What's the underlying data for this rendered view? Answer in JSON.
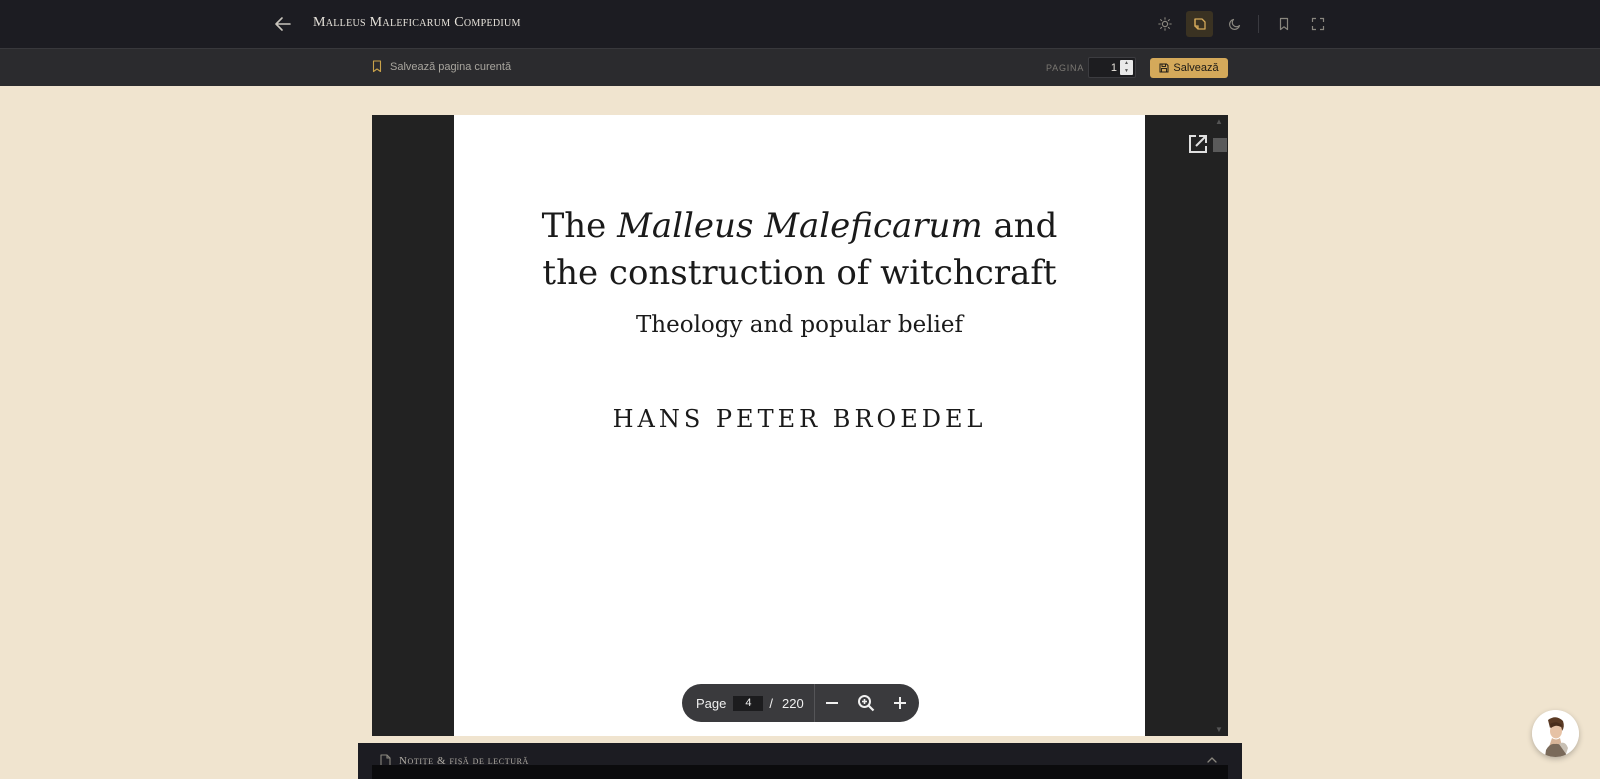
{
  "header": {
    "title": "Malleus Maleficarum Compedium",
    "icons": [
      "arrow-left-icon",
      "sun-icon",
      "book-reader-icon",
      "moon-icon",
      "bookmark-icon",
      "fullscreen-icon"
    ],
    "active_mode": "book-reader-icon",
    "accent": "#d4a95a"
  },
  "subbar": {
    "bookmark_label": "Salvează pagina curentă",
    "page_label": "PAGINA",
    "page_value": "1",
    "save_label": "Salvează"
  },
  "document": {
    "title_line1_pre": "The ",
    "title_line1_italic": "Malleus Maleficarum",
    "title_line1_post": " and",
    "title_line2": "the construction of witchcraft",
    "subtitle": "Theology and popular belief",
    "author": "HANS PETER BROEDEL"
  },
  "page_nav": {
    "label": "Page",
    "current": "4",
    "separator": "/",
    "total": "220"
  },
  "notes": {
    "title": "Notițe & fișă de lectură"
  },
  "colors": {
    "background": "#f0e4cf",
    "topbar": "#1c1c22",
    "subbar": "#2b2b2e",
    "viewer": "#222222"
  }
}
